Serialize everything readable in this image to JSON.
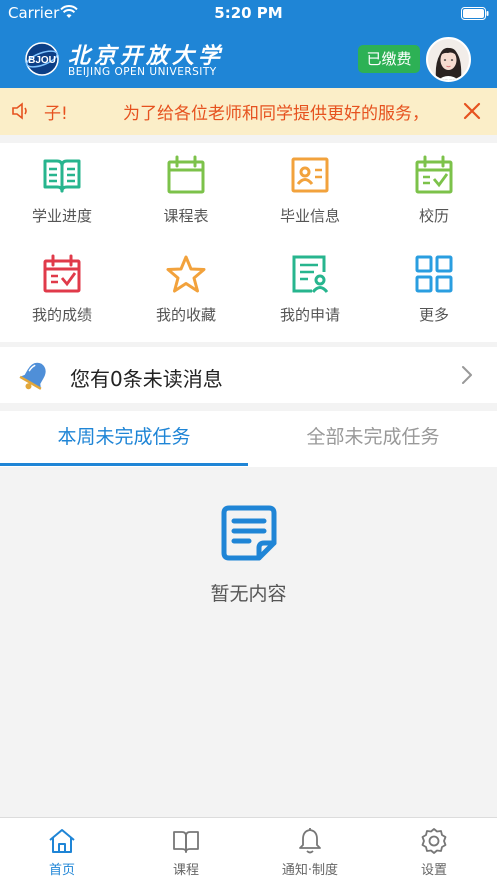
{
  "status_bar": {
    "carrier": "Carrier",
    "time": "5:20 PM"
  },
  "header": {
    "logo_mark_text": "BJOU",
    "university_name_cn": "北京开放大学",
    "university_name_en": "BEIJING OPEN UNIVERSITY",
    "paid_badge": "已缴费",
    "brand_color": "#1f85d6"
  },
  "notice": {
    "label": "子!",
    "text": "为了给各位老师和同学提供更好的服务，",
    "color": "#e6521f"
  },
  "grid": {
    "items": [
      {
        "label": "学业进度",
        "icon": "open-book-icon"
      },
      {
        "label": "课程表",
        "icon": "calendar-icon"
      },
      {
        "label": "毕业信息",
        "icon": "id-card-icon"
      },
      {
        "label": "校历",
        "icon": "calendar-check-icon"
      },
      {
        "label": "我的成绩",
        "icon": "grade-calendar-icon"
      },
      {
        "label": "我的收藏",
        "icon": "star-icon"
      },
      {
        "label": "我的申请",
        "icon": "application-form-icon"
      },
      {
        "label": "更多",
        "icon": "grid-more-icon"
      }
    ]
  },
  "message": {
    "text": "您有0条未读消息"
  },
  "tabs": {
    "active": "本周未完成任务",
    "inactive": "全部未完成任务"
  },
  "empty": {
    "text": "暂无内容"
  },
  "tabbar": {
    "items": [
      {
        "label": "首页",
        "icon": "home-icon",
        "active": true
      },
      {
        "label": "课程",
        "icon": "book-icon",
        "active": false
      },
      {
        "label": "通知·制度",
        "icon": "bell-icon",
        "active": false
      },
      {
        "label": "设置",
        "icon": "gear-icon",
        "active": false
      }
    ]
  }
}
